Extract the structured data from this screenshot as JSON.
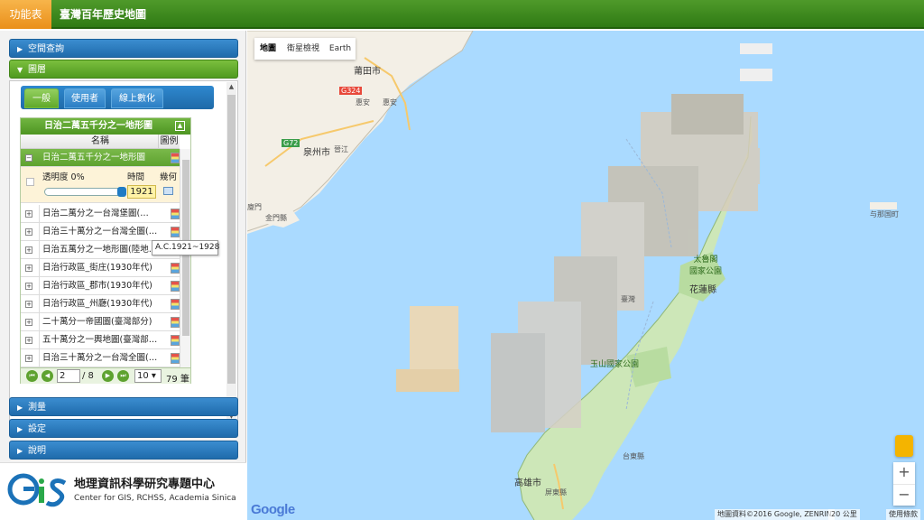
{
  "topbar": {
    "menu_label": "功能表",
    "app_title": "臺灣百年歷史地圖"
  },
  "accordion": {
    "space_query": "空間查詢",
    "layers": "圖層",
    "measure": "測量",
    "settings": "設定",
    "help": "說明"
  },
  "tabs": {
    "general": "一般",
    "user": "使用者",
    "online_digitize": "線上數化"
  },
  "layer_panel": {
    "title": "日治二萬五千分之一地形圖",
    "col_name": "名稱",
    "col_legend": "圖例",
    "selected_row": "日治二萬五千分之一地形圖",
    "opacity_label": "透明度 0%",
    "time_label": "時間",
    "geo_label": "幾何",
    "year_value": "1921",
    "rows": [
      "日治二萬分之一台灣堡圖(…",
      "日治三十萬分之一台灣全圖(…",
      "日治五萬分之一地形圖(陸地…",
      "日治行政區_街庄(1930年代)",
      "日治行政區_郡市(1930年代)",
      "日治行政區_州廳(1930年代)",
      "二十萬分一帝國圖(臺灣部分)",
      "五十萬分之一輿地圖(臺灣部…",
      "日治三十萬分之一台灣全圖(…"
    ],
    "tooltip": "A.C.1921~1928"
  },
  "pager": {
    "page": "2",
    "of_pages": "/ 8",
    "page_size": "10",
    "count": "79 筆"
  },
  "footer": {
    "org_name": "地理資訊科學研究專題中心",
    "org_en": "Center for GIS, RCHSS, Academia Sinica",
    "logo_text": "GiS"
  },
  "map": {
    "type_buttons": [
      "地圖",
      "衛星檢視",
      "Earth"
    ],
    "labels": {
      "putian": "莆田市",
      "quanzhou": "泉州市",
      "jinmen": "金門縣",
      "taiwan": "臺灣",
      "hualien": "花蓮縣",
      "taroko": "太魯閣\n國家公園",
      "yushan": "玉山國家公園",
      "kaohsiung": "高雄市",
      "pingtung": "屏東縣",
      "taitung": "台東縣",
      "yonaguni": "与那国町",
      "road_g324": "G324",
      "road_g72": "G72",
      "huian": "惠安",
      "nanan": "南安",
      "jinjiang": "晉江",
      "xiamen": "廈門"
    },
    "attribution": "地圖資料©2016 Google, ZENRIN",
    "scale": "20 公里",
    "terms": "使用條款",
    "google": "Google"
  }
}
